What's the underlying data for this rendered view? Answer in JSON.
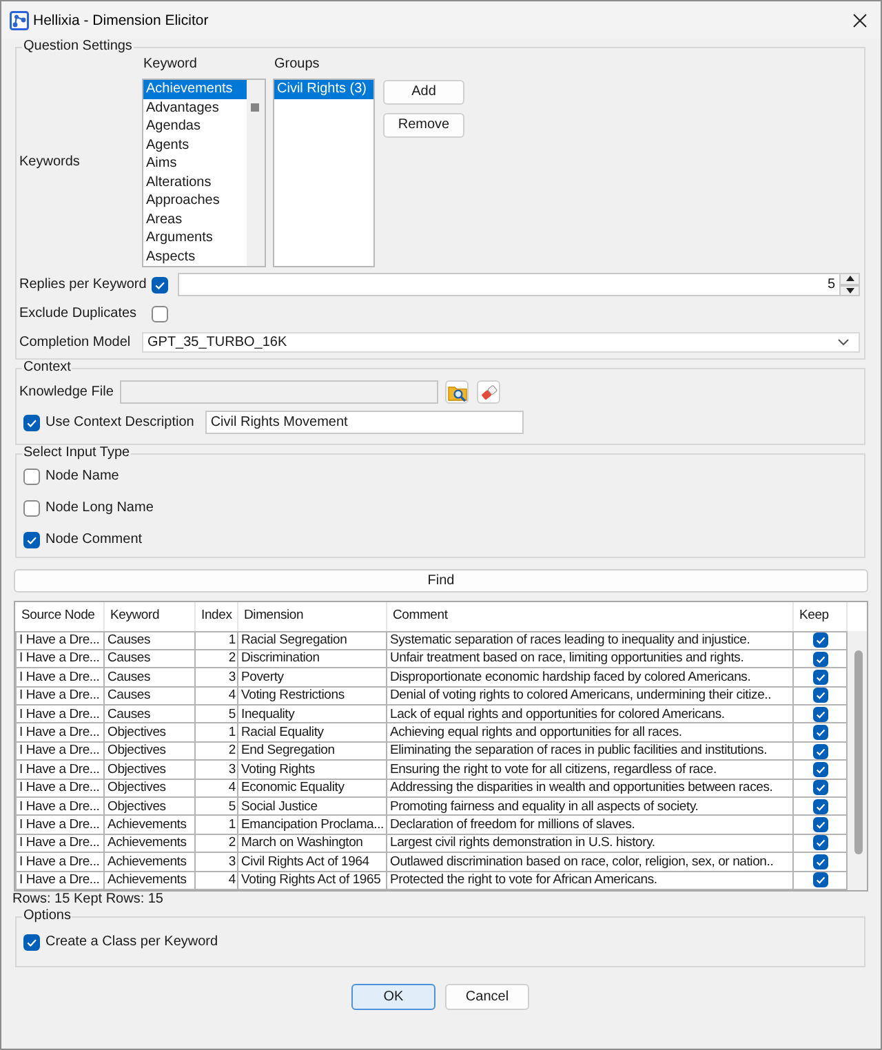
{
  "window": {
    "title": "Hellixia - Dimension Elicitor"
  },
  "question_settings": {
    "title": "Question Settings",
    "keywords_label": "Keywords",
    "keyword_header": "Keyword",
    "keywords": [
      {
        "label": "Achievements",
        "selected": true
      },
      {
        "label": "Advantages",
        "selected": false
      },
      {
        "label": "Agendas",
        "selected": false
      },
      {
        "label": "Agents",
        "selected": false
      },
      {
        "label": "Aims",
        "selected": false
      },
      {
        "label": "Alterations",
        "selected": false
      },
      {
        "label": "Approaches",
        "selected": false
      },
      {
        "label": "Areas",
        "selected": false
      },
      {
        "label": "Arguments",
        "selected": false
      },
      {
        "label": "Aspects",
        "selected": false
      }
    ],
    "groups_header": "Groups",
    "groups": [
      {
        "label": "Civil Rights (3)",
        "selected": true
      }
    ],
    "buttons": [
      "Add",
      "Remove"
    ],
    "replies": {
      "label": "Replies per Keyword",
      "checked": true,
      "value": "5"
    },
    "exclude_duplicates": {
      "label": "Exclude Duplicates",
      "checked": false
    },
    "completion_model": {
      "label": "Completion Model",
      "value": "GPT_35_TURBO_16K"
    }
  },
  "context": {
    "title": "Context",
    "knowledge_file": {
      "label": "Knowledge File",
      "disabled": true
    },
    "use_description": {
      "label": "Use Context Description",
      "checked": true,
      "value": "Civil Rights Movement"
    }
  },
  "input_type": {
    "title": "Select Input Type",
    "options": [
      {
        "label": "Node Name",
        "checked": false
      },
      {
        "label": "Node Long Name",
        "checked": false
      },
      {
        "label": "Node Comment",
        "checked": true
      }
    ]
  },
  "find_button": "Find",
  "table": {
    "columns": [
      "Source Node",
      "Keyword",
      "Index",
      "Dimension",
      "Comment",
      "Keep"
    ],
    "rows": [
      {
        "source_node": "I Have a Dre...",
        "keyword": "Causes",
        "index": "1",
        "dimension": "Racial Segregation",
        "comment": "Systematic separation of races leading to inequality and injustice.",
        "keep": true
      },
      {
        "source_node": "I Have a Dre...",
        "keyword": "Causes",
        "index": "2",
        "dimension": "Discrimination",
        "comment": "Unfair treatment based on race, limiting opportunities and rights.",
        "keep": true
      },
      {
        "source_node": "I Have a Dre...",
        "keyword": "Causes",
        "index": "3",
        "dimension": "Poverty",
        "comment": "Disproportionate economic hardship faced by colored Americans.",
        "keep": true
      },
      {
        "source_node": "I Have a Dre...",
        "keyword": "Causes",
        "index": "4",
        "dimension": "Voting Restrictions",
        "comment": "Denial of voting rights to colored Americans, undermining their citize..",
        "keep": true
      },
      {
        "source_node": "I Have a Dre...",
        "keyword": "Causes",
        "index": "5",
        "dimension": "Inequality",
        "comment": "Lack of equal rights and opportunities for colored Americans.",
        "keep": true
      },
      {
        "source_node": "I Have a Dre...",
        "keyword": "Objectives",
        "index": "1",
        "dimension": "Racial Equality",
        "comment": "Achieving equal rights and opportunities for all races.",
        "keep": true
      },
      {
        "source_node": "I Have a Dre...",
        "keyword": "Objectives",
        "index": "2",
        "dimension": "End Segregation",
        "comment": "Eliminating the separation of races in public facilities and institutions.",
        "keep": true
      },
      {
        "source_node": "I Have a Dre...",
        "keyword": "Objectives",
        "index": "3",
        "dimension": "Voting Rights",
        "comment": "Ensuring the right to vote for all citizens, regardless of race.",
        "keep": true
      },
      {
        "source_node": "I Have a Dre...",
        "keyword": "Objectives",
        "index": "4",
        "dimension": "Economic Equality",
        "comment": "Addressing the disparities in wealth and opportunities between races.",
        "keep": true
      },
      {
        "source_node": "I Have a Dre...",
        "keyword": "Objectives",
        "index": "5",
        "dimension": "Social Justice",
        "comment": "Promoting fairness and equality in all aspects of society.",
        "keep": true
      },
      {
        "source_node": "I Have a Dre...",
        "keyword": "Achievements",
        "index": "1",
        "dimension": "Emancipation Proclama...",
        "comment": "Declaration of freedom for millions of slaves.",
        "keep": true
      },
      {
        "source_node": "I Have a Dre...",
        "keyword": "Achievements",
        "index": "2",
        "dimension": "March on Washington",
        "comment": "Largest civil rights demonstration in U.S. history.",
        "keep": true
      },
      {
        "source_node": "I Have a Dre...",
        "keyword": "Achievements",
        "index": "3",
        "dimension": "Civil Rights Act of 1964",
        "comment": "Outlawed discrimination based on race, color, religion, sex, or nation..",
        "keep": true
      },
      {
        "source_node": "I Have a Dre...",
        "keyword": "Achievements",
        "index": "4",
        "dimension": "Voting Rights Act of 1965",
        "comment": "Protected the right to vote for African Americans.",
        "keep": true
      }
    ]
  },
  "status": "Rows: 15 Kept Rows: 15",
  "options": {
    "title": "Options",
    "items": [
      {
        "label": "Create a Class per Keyword",
        "checked": true
      }
    ]
  },
  "buttons": [
    {
      "label": "OK",
      "focused": true
    },
    {
      "label": "Cancel",
      "focused": false
    }
  ]
}
